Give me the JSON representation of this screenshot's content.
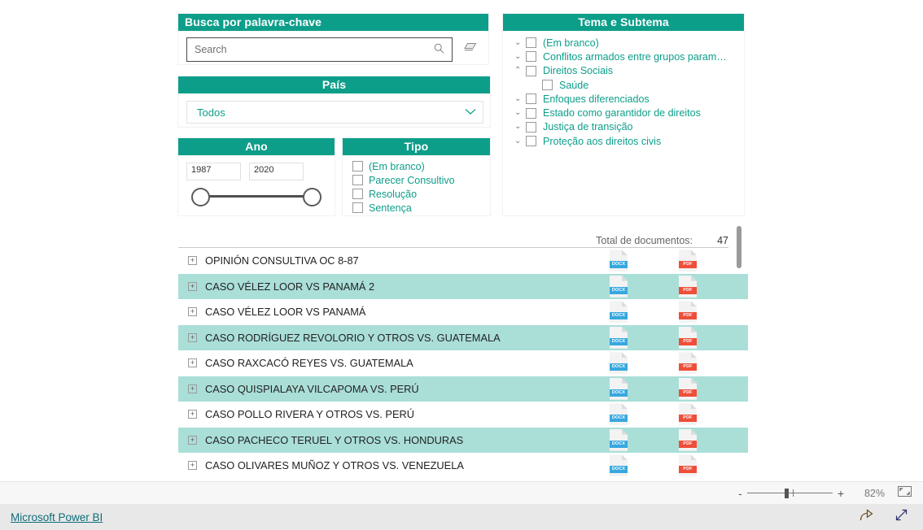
{
  "search_panel": {
    "title": "Busca por palavra-chave",
    "input_value": "",
    "placeholder": "Search",
    "search_icon": "magnifier-icon",
    "clear_icon": "eraser-icon"
  },
  "country_panel": {
    "title": "País",
    "selected": "Todos",
    "chevron_icon": "chevron-down-icon"
  },
  "year_panel": {
    "title": "Ano",
    "min_value": "1987",
    "max_value": "2020"
  },
  "type_panel": {
    "title": "Tipo",
    "options": [
      {
        "label": "(Em branco)",
        "checked": false
      },
      {
        "label": "Parecer Consultivo",
        "checked": false
      },
      {
        "label": "Resolução",
        "checked": false
      },
      {
        "label": "Sentença",
        "checked": false
      }
    ]
  },
  "theme_panel": {
    "title": "Tema e Subtema",
    "items": [
      {
        "label": "(Em branco)",
        "chevron": "⌄",
        "checked": false,
        "child": false
      },
      {
        "label": "Conflitos armados entre grupos param…",
        "chevron": "⌄",
        "checked": false,
        "child": false
      },
      {
        "label": "Direitos Sociais",
        "chevron": "⌃",
        "checked": false,
        "child": false
      },
      {
        "label": "Saúde",
        "chevron": "",
        "checked": false,
        "child": true
      },
      {
        "label": "Enfoques diferenciados",
        "chevron": "⌄",
        "checked": false,
        "child": false
      },
      {
        "label": "Estado como garantidor de direitos",
        "chevron": "⌄",
        "checked": false,
        "child": false
      },
      {
        "label": "Justiça de transição",
        "chevron": "⌄",
        "checked": false,
        "child": false
      },
      {
        "label": "Proteção aos direitos civis",
        "chevron": "⌄",
        "checked": false,
        "child": false
      }
    ]
  },
  "documents": {
    "total_label": "Total de documentos:",
    "total_value": "47",
    "docx_tag": "DOCX",
    "pdf_tag": "PDF",
    "expander_glyph": "+",
    "rows": [
      {
        "title": "OPINIÓN CONSULTIVA OC 8-87"
      },
      {
        "title": "CASO VÉLEZ LOOR VS PANAMÁ 2"
      },
      {
        "title": "CASO VÉLEZ LOOR VS PANAMÁ"
      },
      {
        "title": "CASO RODRÍGUEZ REVOLORIO Y OTROS VS. GUATEMALA"
      },
      {
        "title": "CASO RAXCACÓ REYES VS. GUATEMALA"
      },
      {
        "title": "CASO QUISPIALAYA VILCAPOMA VS. PERÚ"
      },
      {
        "title": "CASO POLLO RIVERA Y OTROS VS. PERÚ"
      },
      {
        "title": "CASO PACHECO TERUEL Y OTROS VS. HONDURAS"
      },
      {
        "title": "CASO OLIVARES MUÑOZ Y OTROS VS. VENEZUELA"
      }
    ]
  },
  "zoom_bar": {
    "minus": "-",
    "plus": "+",
    "percent": "82%",
    "fit_icon": "fit-to-page-icon"
  },
  "footer": {
    "brand": "Microsoft Power BI",
    "share_icon": "share-icon",
    "fullscreen_icon": "focus-mode-icon"
  },
  "colors": {
    "accent_teal": "#0d9e8a",
    "row_highlight": "#aadfd8",
    "docx_blue": "#37a8df",
    "pdf_red": "#ef4e3a",
    "footer_link": "#0e6d7a"
  }
}
